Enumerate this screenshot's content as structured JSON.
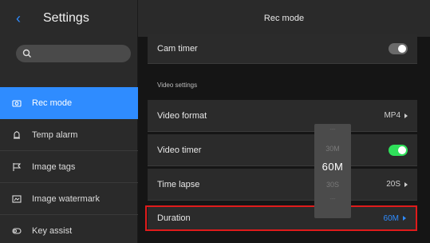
{
  "sidebar": {
    "title": "Settings",
    "search": {
      "placeholder": ""
    },
    "items": [
      {
        "label": "Rec mode",
        "icon": "camera-icon",
        "active": true
      },
      {
        "label": "Temp alarm",
        "icon": "alarm-icon",
        "active": false
      },
      {
        "label": "Image tags",
        "icon": "flag-icon",
        "active": false
      },
      {
        "label": "Image watermark",
        "icon": "watermark-icon",
        "active": false
      },
      {
        "label": "Key assist",
        "icon": "key-assist-icon",
        "active": false
      }
    ]
  },
  "main": {
    "title": "Rec mode",
    "cam_timer": {
      "label": "Cam timer",
      "toggle": "off"
    },
    "section_label": "Video settings",
    "video_format": {
      "label": "Video format",
      "value": "MP4"
    },
    "video_timer": {
      "label": "Video timer",
      "toggle": "on"
    },
    "time_lapse": {
      "label": "Time lapse",
      "value": "20S"
    },
    "duration": {
      "label": "Duration",
      "value": "60M"
    }
  },
  "picker": {
    "options": [
      "---",
      "30M",
      "60M",
      "30S",
      "---"
    ],
    "selected": "60M"
  },
  "colors": {
    "accent": "#2f8cff",
    "toggle_on": "#2fe05a",
    "highlight": "#e01b1b"
  }
}
